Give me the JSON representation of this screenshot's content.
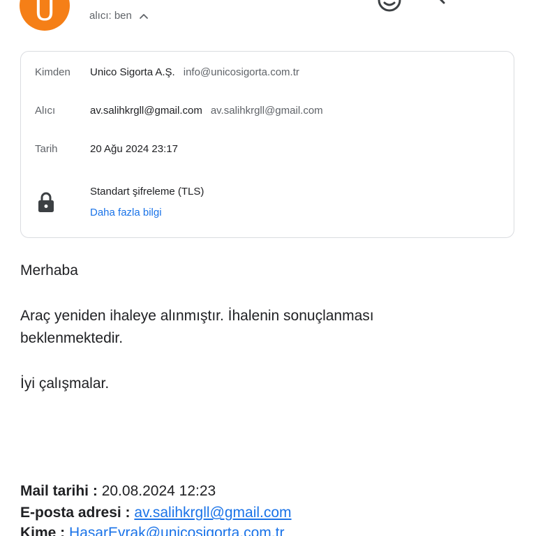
{
  "header": {
    "avatar_letter": "U",
    "recipient_summary": "alıcı: ben"
  },
  "details": {
    "from_label": "Kimden",
    "from_name": "Unico Sigorta A.Ş.",
    "from_email": "info@unicosigorta.com.tr",
    "to_label": "Alıcı",
    "to_name": "av.salihkrgll@gmail.com",
    "to_email": "av.salihkrgll@gmail.com",
    "date_label": "Tarih",
    "date_value": "20 Ağu 2024 23:17",
    "encryption_text": "Standart şifreleme (TLS)",
    "more_info_link": "Daha fazla bilgi"
  },
  "body": {
    "greeting": "Merhaba",
    "paragraph_line1": "Araç yeniden ihaleye alınmıştır. İhalenin sonuçlanması",
    "paragraph_line2": "beklenmektedir.",
    "closing": "İyi çalışmalar."
  },
  "footer": {
    "mail_date_label": "Mail tarihi :",
    "mail_date_value": "20.08.2024 12:23",
    "email_label": "E-posta adresi :",
    "email_value": "av.salihkrgll@gmail.com",
    "to_label": "Kime :",
    "to_value": "HasarEvrak@unicosigorta.com.tr"
  }
}
